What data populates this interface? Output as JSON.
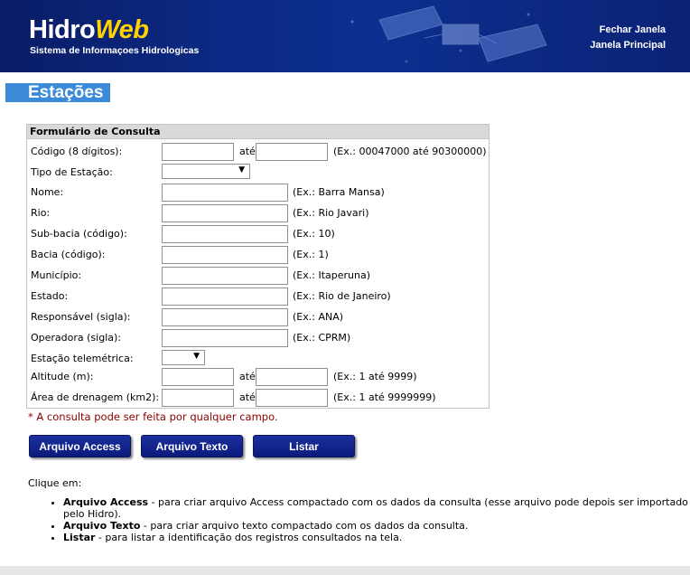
{
  "header": {
    "logo_part1": "Hidro",
    "logo_part2": "Web",
    "subtitle": "Sistema de Informaçoes Hidrologicas",
    "close_link": "Fechar Janela",
    "main_link": "Janela Principal"
  },
  "page_title": "Estações",
  "form": {
    "title": "Formulário de Consulta",
    "fields": {
      "codigo": {
        "label": "Código (8 dígitos):",
        "ate": "até",
        "example": "(Ex.: 00047000 até 90300000)",
        "from_value": "",
        "to_value": ""
      },
      "tipo": {
        "label": "Tipo de Estação:",
        "selected": ""
      },
      "nome": {
        "label": "Nome:",
        "example": "(Ex.: Barra Mansa)",
        "value": ""
      },
      "rio": {
        "label": "Rio:",
        "example": "(Ex.: Rio Javari)",
        "value": ""
      },
      "subbacia": {
        "label": "Sub-bacia (código):",
        "example": "(Ex.: 10)",
        "value": ""
      },
      "bacia": {
        "label": "Bacia (código):",
        "example": "(Ex.: 1)",
        "value": ""
      },
      "municipio": {
        "label": "Município:",
        "example": "(Ex.: Itaperuna)",
        "value": ""
      },
      "estado": {
        "label": "Estado:",
        "example": "(Ex.: Rio de Janeiro)",
        "value": ""
      },
      "responsavel": {
        "label": "Responsável (sigla):",
        "example": "(Ex.: ANA)",
        "value": ""
      },
      "operadora": {
        "label": "Operadora (sigla):",
        "example": "(Ex.: CPRM)",
        "value": ""
      },
      "telemetrica": {
        "label": "Estação telemétrica:",
        "selected": ""
      },
      "altitude": {
        "label": "Altitude (m):",
        "ate": "até",
        "example": "(Ex.: 1 até 9999)",
        "from_value": "",
        "to_value": ""
      },
      "drenagem": {
        "label": "Área de drenagem (km2):",
        "ate": "até",
        "example": "(Ex.: 1 até 9999999)",
        "from_value": "",
        "to_value": ""
      }
    },
    "note": "* A consulta pode ser feita por qualquer campo."
  },
  "buttons": {
    "access": "Arquivo Access",
    "texto": "Arquivo Texto",
    "listar": "Listar"
  },
  "help": {
    "intro": "Clique em:",
    "items": [
      {
        "term": "Arquivo Access",
        "desc": " - para criar arquivo Access compactado com os dados da consulta (esse arquivo pode depois ser importado pelo Hidro)."
      },
      {
        "term": "Arquivo Texto",
        "desc": " - para criar arquivo texto compactado com os dados da consulta."
      },
      {
        "term": "Listar",
        "desc": " - para listar a identificação dos registros consultados na tela."
      }
    ]
  },
  "icons": {
    "dropdown": "chevron-down-icon",
    "satellite": "satellite-image"
  },
  "colors": {
    "header_bg": "#0b2a86",
    "logo_accent": "#ffd200",
    "title_bg": "#3b8bd8",
    "button_bg": "#12248c",
    "note": "#8b0000"
  }
}
